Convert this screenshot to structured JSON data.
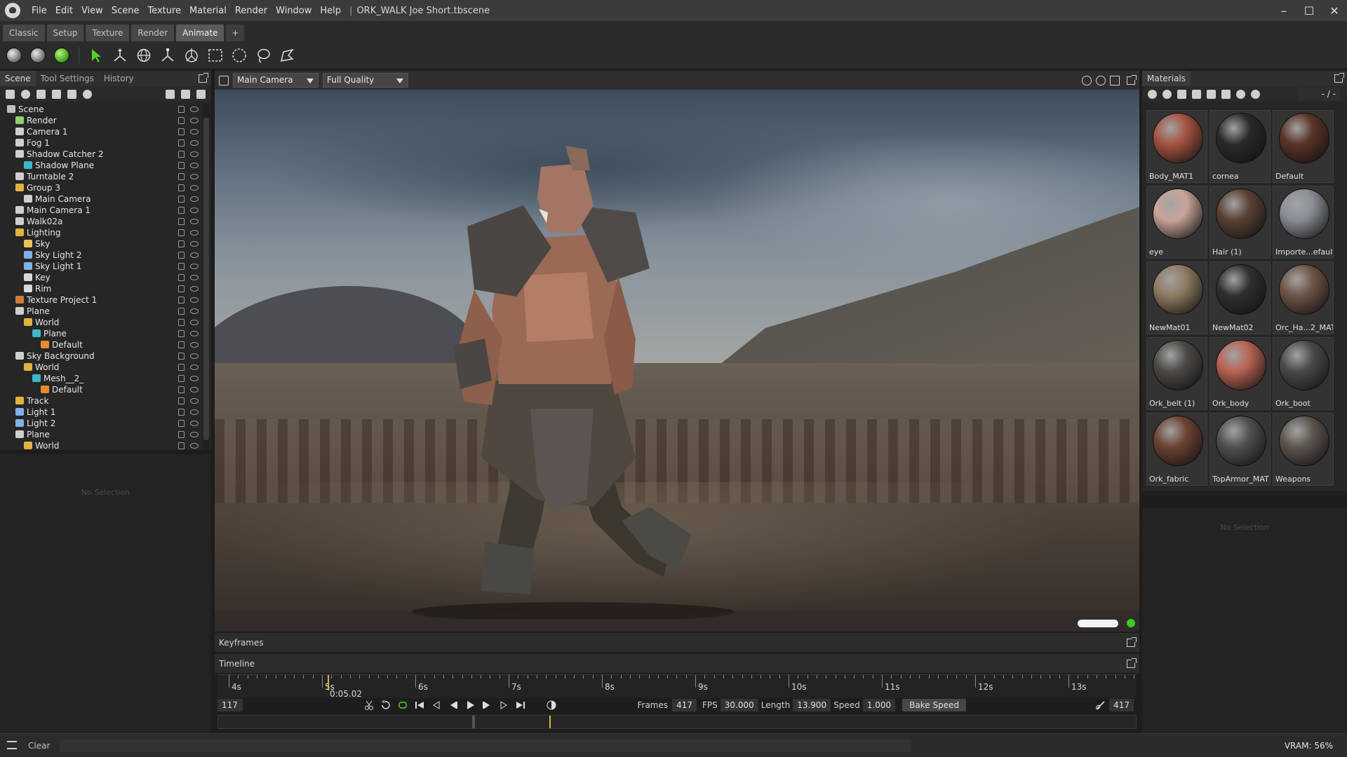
{
  "titlebar": {
    "menu": [
      "File",
      "Edit",
      "View",
      "Scene",
      "Texture",
      "Material",
      "Render",
      "Window",
      "Help"
    ],
    "separator": "|",
    "document": "ORK_WALK Joe Short.tbscene",
    "controls": [
      "minimize-icon",
      "maximize-icon",
      "close-icon"
    ]
  },
  "workspace_tabs": [
    "Classic",
    "Setup",
    "Texture",
    "Render",
    "Animate",
    "+"
  ],
  "active_workspace": "Animate",
  "scene_panel": {
    "tabs": [
      "Scene",
      "Tool Settings",
      "History"
    ],
    "active_tab": "Scene",
    "no_selection": "No Selection",
    "tree": [
      {
        "label": "Scene",
        "depth": 0,
        "icon": "scene-icon",
        "color": "#bfbfbf"
      },
      {
        "label": "Render",
        "depth": 1,
        "icon": "render-icon",
        "color": "#8fd16a"
      },
      {
        "label": "Camera 1",
        "depth": 1,
        "icon": "camera-icon",
        "color": "#cfcfcf"
      },
      {
        "label": "Fog 1",
        "depth": 1,
        "icon": "fog-icon",
        "color": "#cfcfcf"
      },
      {
        "label": "Shadow Catcher 2",
        "depth": 1,
        "icon": "shadow-catcher-icon",
        "color": "#cfcfcf"
      },
      {
        "label": "Shadow Plane",
        "depth": 2,
        "icon": "mesh-icon",
        "color": "#3fb6c9"
      },
      {
        "label": "Turntable 2",
        "depth": 1,
        "icon": "turntable-icon",
        "color": "#cfcfcf"
      },
      {
        "label": "Group 3",
        "depth": 1,
        "icon": "folder-icon",
        "color": "#e2b33e"
      },
      {
        "label": "Main Camera",
        "depth": 2,
        "icon": "camera-icon",
        "color": "#cfcfcf"
      },
      {
        "label": "Main Camera 1",
        "depth": 1,
        "icon": "camera-icon",
        "color": "#cfcfcf"
      },
      {
        "label": "Walk02a",
        "depth": 1,
        "icon": "file-icon",
        "color": "#cfcfcf"
      },
      {
        "label": "Lighting",
        "depth": 1,
        "icon": "folder-icon",
        "color": "#e2b33e"
      },
      {
        "label": "Sky",
        "depth": 2,
        "icon": "sky-icon",
        "color": "#e8c35a"
      },
      {
        "label": "Sky Light 2",
        "depth": 2,
        "icon": "light-icon",
        "color": "#7fb2e6"
      },
      {
        "label": "Sky Light 1",
        "depth": 2,
        "icon": "light-icon",
        "color": "#7fb2e6"
      },
      {
        "label": "Key",
        "depth": 2,
        "icon": "light-icon",
        "color": "#d9d9d9"
      },
      {
        "label": "Rim",
        "depth": 2,
        "icon": "light-icon",
        "color": "#d9d9d9"
      },
      {
        "label": "Texture Project 1",
        "depth": 1,
        "icon": "texture-project-icon",
        "color": "#d07a3a"
      },
      {
        "label": "Plane",
        "depth": 1,
        "icon": "file-icon",
        "color": "#cfcfcf"
      },
      {
        "label": "World",
        "depth": 2,
        "icon": "folder-icon",
        "color": "#e2b33e"
      },
      {
        "label": "Plane",
        "depth": 3,
        "icon": "mesh-icon",
        "color": "#3fb6c9"
      },
      {
        "label": "Default",
        "depth": 4,
        "icon": "material-icon",
        "color": "#e58a2e"
      },
      {
        "label": "Sky Background",
        "depth": 1,
        "icon": "file-icon",
        "color": "#cfcfcf"
      },
      {
        "label": "World",
        "depth": 2,
        "icon": "folder-icon",
        "color": "#e2b33e"
      },
      {
        "label": "Mesh__2_",
        "depth": 3,
        "icon": "mesh-icon",
        "color": "#3fb6c9"
      },
      {
        "label": "Default",
        "depth": 4,
        "icon": "material-icon",
        "color": "#e58a2e"
      },
      {
        "label": "Track",
        "depth": 1,
        "icon": "folder-icon",
        "color": "#e2b33e"
      },
      {
        "label": "Light 1",
        "depth": 1,
        "icon": "light-icon",
        "color": "#7fb2e6"
      },
      {
        "label": "Light 2",
        "depth": 1,
        "icon": "light-icon",
        "color": "#7fb2e6"
      },
      {
        "label": "Plane",
        "depth": 1,
        "icon": "file-icon",
        "color": "#cfcfcf"
      },
      {
        "label": "World",
        "depth": 2,
        "icon": "folder-icon",
        "color": "#e2b33e"
      }
    ]
  },
  "viewport": {
    "camera": "Main Camera",
    "quality": "Full Quality",
    "no_selection": "No Selection"
  },
  "keyframes": {
    "title": "Keyframes"
  },
  "timeline": {
    "title": "Timeline",
    "ticks": [
      "4s",
      "5s",
      "6s",
      "7s",
      "8s",
      "9s",
      "10s",
      "11s",
      "12s",
      "13s"
    ],
    "playhead_label": "0:05.02",
    "current_frame": "117",
    "frames_label": "Frames",
    "frames": "417",
    "fps_label": "FPS",
    "fps": "30.000",
    "length_label": "Length",
    "length": "13.900",
    "speed_label": "Speed",
    "speed": "1.000",
    "bake_label": "Bake Speed",
    "end_frame": "417"
  },
  "materials": {
    "title": "Materials",
    "counter": "- / -",
    "no_selection": "No Selection",
    "items": [
      {
        "name": "Body_MAT1",
        "color": "#a5533f"
      },
      {
        "name": "cornea",
        "color": "#2a2a2a"
      },
      {
        "name": "Default",
        "color": "#5a3326"
      },
      {
        "name": "eye",
        "color": "#c9a49a"
      },
      {
        "name": "Hair (1)",
        "color": "#5a4034"
      },
      {
        "name": "Importe...efault",
        "color": "#8a8e94"
      },
      {
        "name": "NewMat01",
        "color": "#8d7a60"
      },
      {
        "name": "NewMat02",
        "color": "#2f2f2f"
      },
      {
        "name": "Orc_Ha...2_MAT",
        "color": "#6e5446"
      },
      {
        "name": "Ork_belt (1)",
        "color": "#4d4946"
      },
      {
        "name": "Ork_body",
        "color": "#b86352"
      },
      {
        "name": "Ork_boot",
        "color": "#4c4a48"
      },
      {
        "name": "Ork_fabric",
        "color": "#6c4233"
      },
      {
        "name": "TopArmor_MAT",
        "color": "#505050"
      },
      {
        "name": "Weapons",
        "color": "#5c554e"
      }
    ]
  },
  "status": {
    "clear_label": "Clear",
    "vram": "VRAM: 56%"
  }
}
